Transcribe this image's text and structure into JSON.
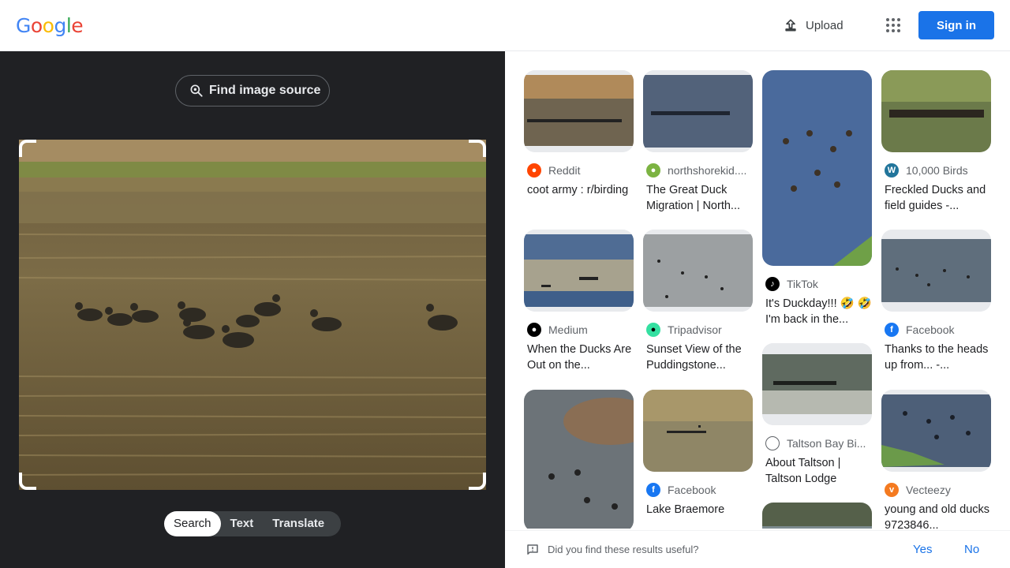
{
  "header": {
    "logo": "Google",
    "upload_label": "Upload",
    "signin_label": "Sign in"
  },
  "left_panel": {
    "find_source_label": "Find image source",
    "tabs": [
      "Search",
      "Text",
      "Translate"
    ],
    "active_tab": "Search"
  },
  "results": [
    {
      "source": "Reddit",
      "source_icon": "reddit-icon",
      "title": "coot army : r/birding"
    },
    {
      "source": "northshorekid....",
      "source_icon": "site-globe-icon",
      "title": "The Great Duck Migration | North..."
    },
    {
      "source": "TikTok",
      "source_icon": "tiktok-icon",
      "title": "It's Duckday!!! 🤣 🤣 I'm back in the..."
    },
    {
      "source": "10,000 Birds",
      "source_icon": "wordpress-icon",
      "title": "Freckled Ducks and field guides -..."
    },
    {
      "source": "Medium",
      "source_icon": "medium-icon",
      "title": "When the Ducks Are Out on the..."
    },
    {
      "source": "Tripadvisor",
      "source_icon": "tripadvisor-icon",
      "title": "Sunset View of the Puddingstone..."
    },
    {
      "source": "Facebook",
      "source_icon": "facebook-icon",
      "title": "Thanks to the heads up from... -..."
    },
    {
      "source": "Taltson Bay Bi...",
      "source_icon": "globe-icon",
      "title": "About Taltson | Taltson Lodge"
    },
    {
      "source": "Facebook",
      "source_icon": "facebook-icon",
      "title": "Lake Braemore"
    },
    {
      "source": "Vecteezy",
      "source_icon": "vecteezy-icon",
      "title": "young and old ducks 9723846..."
    }
  ],
  "feedback": {
    "question": "Did you find these results useful?",
    "yes": "Yes",
    "no": "No"
  },
  "colors": {
    "accent": "#1a73e8",
    "panel_bg": "#202124"
  }
}
